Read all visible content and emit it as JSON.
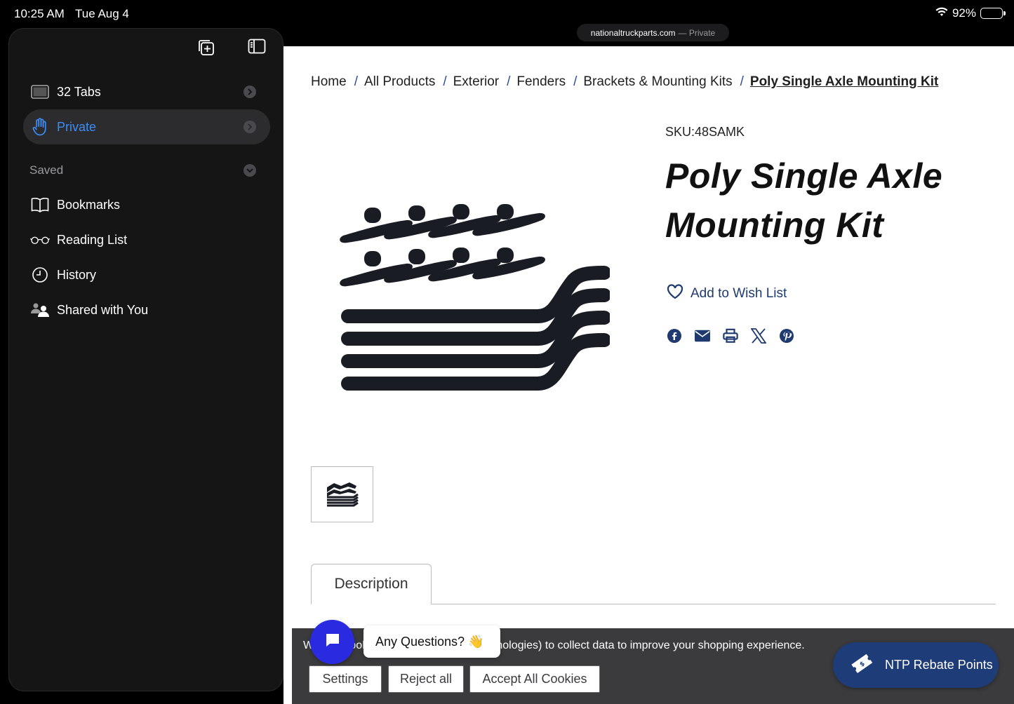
{
  "status_bar": {
    "time": "10:25 AM",
    "date": "Tue Aug 4",
    "battery_text": "92%",
    "battery_level": 0.92
  },
  "address_bar": {
    "domain": "nationaltruckparts.com",
    "mode": "— Private"
  },
  "sidebar": {
    "tabs_label": "32 Tabs",
    "private_label": "Private",
    "saved_label": "Saved",
    "items": [
      {
        "label": "Bookmarks",
        "icon": "book-icon"
      },
      {
        "label": "Reading List",
        "icon": "glasses-icon"
      },
      {
        "label": "History",
        "icon": "clock-icon"
      },
      {
        "label": "Shared with You",
        "icon": "shared-people-icon"
      }
    ],
    "accent_color": "#3d8cf4"
  },
  "breadcrumb": [
    "Home",
    "All Products",
    "Exterior",
    "Fenders",
    "Brackets & Mounting Kits",
    "Poly Single Axle Mounting Kit"
  ],
  "product": {
    "sku": "SKU:48SAMK",
    "title": "Poly Single Axle Mounting Kit",
    "wishlist_label": "Add to Wish List",
    "share_icons": [
      "facebook-icon",
      "email-icon",
      "print-icon",
      "x-icon",
      "pinterest-icon"
    ]
  },
  "tabs": {
    "description_label": "Description"
  },
  "cookie_banner": {
    "message": "We use cookies (and other similar technologies) to collect data to improve your shopping experience.",
    "settings_label": "Settings",
    "reject_label": "Reject all",
    "accept_label": "Accept All Cookies"
  },
  "chat": {
    "prompt": "Any Questions? 👋"
  },
  "rebate": {
    "label": "NTP Rebate Points",
    "color": "#1d3c78"
  }
}
